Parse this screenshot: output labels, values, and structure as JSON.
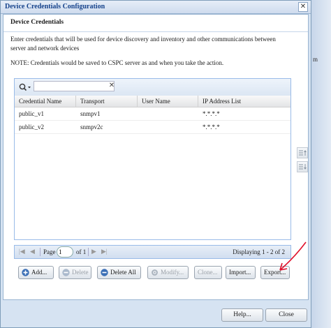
{
  "dialog": {
    "title": "Device Credentials Configuration",
    "close_glyph": "✕"
  },
  "panel": {
    "section_title": "Device Credentials",
    "description": "Enter credentials that will be used for device discovery and inventory and other communications between server and network devices",
    "note": "NOTE: Credentials would be saved to CSPC server as and when you take the action."
  },
  "search": {
    "value": "",
    "placeholder": "",
    "clear_glyph": "✕"
  },
  "table": {
    "columns": [
      "Credential Name",
      "Transport",
      "User Name",
      "IP Address List"
    ],
    "rows": [
      {
        "name": "public_v1",
        "transport": "snmpv1",
        "user": "",
        "ip": "*.*.*.*"
      },
      {
        "name": "public_v2",
        "transport": "snmpv2c",
        "user": "",
        "ip": "*.*.*.*"
      }
    ]
  },
  "pager": {
    "page_label": "Page",
    "page_value": "1",
    "of_label": "of 1",
    "display_text": "Displaying 1 - 2 of 2"
  },
  "actions": {
    "add": "Add...",
    "delete": "Delete",
    "delete_all": "Delete All",
    "modify": "Modify...",
    "clone": "Clone...",
    "import": "Import...",
    "export": "Export..."
  },
  "footer": {
    "help": "Help...",
    "close": "Close"
  },
  "edge": {
    "a": "",
    "b": "m"
  },
  "colors": {
    "annotation_arrow": "#e0102a",
    "accent": "#15428b"
  }
}
